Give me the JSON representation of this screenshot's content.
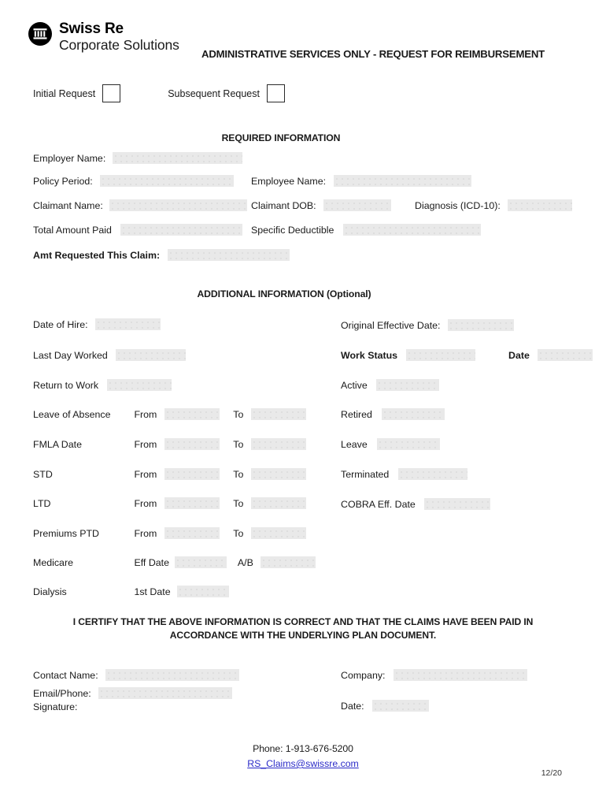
{
  "brand": {
    "logo_line1": "Swiss Re",
    "logo_line2": "Corporate Solutions",
    "logo_icon": "swiss-re-temple-icon"
  },
  "document": {
    "title": "ADMINISTRATIVE SERVICES ONLY - REQUEST FOR REIMBURSEMENT"
  },
  "request_type": {
    "initial_label": "Initial Request",
    "subsequent_label": "Subsequent Request",
    "initial_checked": false,
    "subsequent_checked": false
  },
  "required_section": {
    "heading": "REQUIRED INFORMATION",
    "employer_name_label": "Employer Name:",
    "employer_name_value": "",
    "policy_period_label": "Policy Period:",
    "policy_period_value": "",
    "employee_name_label": "Employee Name:",
    "employee_name_value": "",
    "claimant_name_label": "Claimant Name:",
    "claimant_name_value": "",
    "claimant_dob_label": "Claimant DOB:",
    "claimant_dob_value": "",
    "diagnosis_label": "Diagnosis (ICD-10):",
    "diagnosis_value": "",
    "total_amount_paid_label": "Total Amount Paid",
    "total_amount_paid_value": "",
    "specific_deductible_label": "Specific Deductible",
    "specific_deductible_value": "",
    "amt_requested_label": "Amt Requested This Claim:",
    "amt_requested_value": ""
  },
  "additional_section": {
    "heading": "ADDITIONAL INFORMATION (Optional)",
    "date_of_hire_label": "Date of Hire:",
    "date_of_hire_value": "",
    "original_effective_date_label": "Original Effective Date:",
    "original_effective_date_value": "",
    "last_day_worked_label": "Last Day Worked",
    "last_day_worked_value": "",
    "work_status_label": "Work Status",
    "work_status_value": "",
    "date_label": "Date",
    "date_value": "",
    "return_to_work_label": "Return to Work",
    "return_to_work_value": "",
    "active_label": "Active",
    "active_value": "",
    "leave_of_absence_label": "Leave of Absence",
    "leave_of_absence_from_value": "",
    "leave_of_absence_to_value": "",
    "retired_label": "Retired",
    "retired_value": "",
    "fmla_date_label": "FMLA Date",
    "fmla_from_value": "",
    "fmla_to_value": "",
    "leave_label": "Leave",
    "leave_value": "",
    "std_label": "STD",
    "std_from_value": "",
    "std_to_value": "",
    "terminated_label": "Terminated",
    "terminated_value": "",
    "ltd_label": "LTD",
    "ltd_from_value": "",
    "ltd_to_value": "",
    "cobra_label": "COBRA Eff. Date",
    "cobra_value": "",
    "premiums_ptd_label": "Premiums PTD",
    "premiums_ptd_from_value": "",
    "premiums_ptd_to_value": "",
    "medicare_label": "Medicare",
    "medicare_eff_date_label": "Eff Date",
    "medicare_eff_date_value": "",
    "medicare_ab_label": "A/B",
    "medicare_ab_value": "",
    "dialysis_label": "Dialysis",
    "dialysis_first_date_label": "1st Date",
    "dialysis_first_date_value": "",
    "from_label": "From",
    "to_label": "To"
  },
  "certification": {
    "line1": "I CERTIFY THAT THE ABOVE INFORMATION IS CORRECT AND THAT THE CLAIMS HAVE BEEN PAID IN",
    "line2": "ACCORDANCE WITH THE UNDERLYING PLAN DOCUMENT."
  },
  "signature_section": {
    "contact_name_label": "Contact Name:",
    "contact_name_value": "",
    "company_label": "Company:",
    "company_value": "",
    "email_phone_label": "Email/Phone:",
    "email_phone_value": "",
    "signature_label": "Signature:",
    "date_label": "Date:",
    "date_value": ""
  },
  "footer": {
    "phone": "Phone:  1-913-676-5200",
    "email": "RS_Claims@swissre.com",
    "page_number": "12/20"
  },
  "colors": {
    "field_fill": "#e9e9e9",
    "link": "#2b2bc8",
    "text": "#1a1a1a",
    "logo": "#000000"
  }
}
